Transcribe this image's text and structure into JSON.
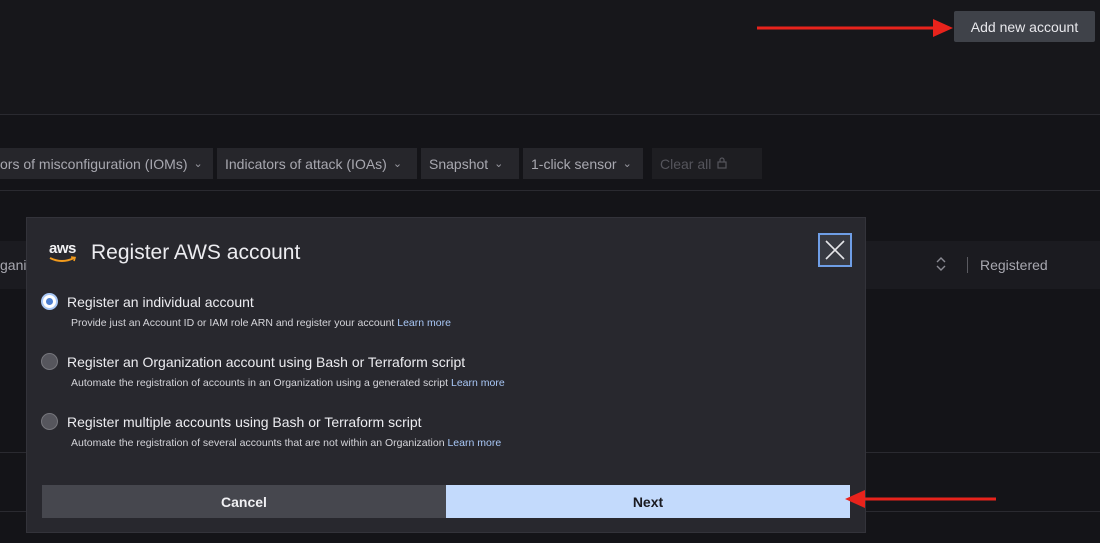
{
  "header": {
    "add_account_label": "Add new account"
  },
  "filters": [
    {
      "label": "ors of misconfiguration (IOMs)"
    },
    {
      "label": "Indicators of attack (IOAs)"
    },
    {
      "label": "Snapshot"
    },
    {
      "label": "1-click sensor"
    }
  ],
  "clear_all_label": "Clear all",
  "table": {
    "partial_column": "gani",
    "registered_column": "Registered"
  },
  "modal": {
    "logo_text": "aws",
    "title": "Register AWS account",
    "options": [
      {
        "label": "Register an individual account",
        "description": "Provide just an Account ID or IAM role ARN and register your account",
        "link": "Learn more",
        "checked": true
      },
      {
        "label": "Register an Organization account using Bash or Terraform script",
        "description": "Automate the registration of accounts in an Organization using a generated script",
        "link": "Learn more",
        "checked": false
      },
      {
        "label": "Register multiple accounts using Bash or Terraform script",
        "description": "Automate the registration of several accounts that are not within an Organization",
        "link": "Learn more",
        "checked": false
      }
    ],
    "cancel_label": "Cancel",
    "next_label": "Next"
  },
  "colors": {
    "annotation_arrow": "#e8231c",
    "primary_button": "#c3dafc",
    "link": "#a9c8f7"
  }
}
